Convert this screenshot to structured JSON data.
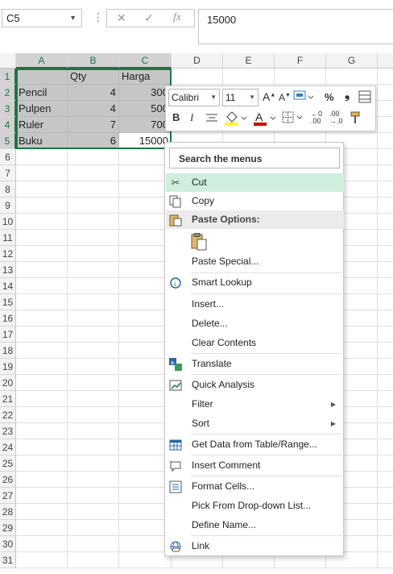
{
  "formula_bar": {
    "name_box": "C5",
    "cancel_icon": "✕",
    "enter_icon": "✓",
    "fx_icon": "fx",
    "dots": "⋮",
    "formula_value": "15000"
  },
  "columns": [
    "A",
    "B",
    "C",
    "D",
    "E",
    "F",
    "G"
  ],
  "rows": [
    "1",
    "2",
    "3",
    "4",
    "5",
    "6",
    "7",
    "8",
    "9",
    "10",
    "11",
    "12",
    "13",
    "14",
    "15",
    "16",
    "17",
    "18",
    "19",
    "20",
    "21",
    "22",
    "23",
    "24",
    "25",
    "26",
    "27",
    "28",
    "29",
    "30",
    "31"
  ],
  "cells": {
    "b1": "Qty",
    "c1": "Harga",
    "a2": "Pencil",
    "b2": "4",
    "c2": "300",
    "a3": "Pulpen",
    "b3": "4",
    "c3": "500",
    "a4": "Ruler",
    "b4": "7",
    "c4": "700",
    "a5": "Buku",
    "b5": "6",
    "c5": "15000"
  },
  "mini_toolbar": {
    "font": "Calibri",
    "size": "11",
    "grow_font": "A",
    "shrink_font": "A",
    "percent": "%",
    "comma": "❟",
    "bold": "B",
    "italic": "I",
    "font_color_letter": "A",
    "fill_color": "#ffff00",
    "font_color": "#d00000"
  },
  "menu": {
    "search_placeholder": "Search the menus",
    "items": {
      "cut": "Cut",
      "copy": "Copy",
      "paste_options": "Paste Options:",
      "paste_special": "Paste Special...",
      "smart_lookup": "Smart Lookup",
      "insert": "Insert...",
      "delete": "Delete...",
      "clear_contents": "Clear Contents",
      "translate": "Translate",
      "quick_analysis": "Quick Analysis",
      "filter": "Filter",
      "sort": "Sort",
      "get_data": "Get Data from Table/Range...",
      "insert_comment": "Insert Comment",
      "format_cells": "Format Cells...",
      "pick_from_list": "Pick From Drop-down List...",
      "define_name": "Define Name...",
      "link": "Link"
    }
  },
  "colors": {
    "accent": "#217346",
    "highlight": "#cfeedd"
  }
}
